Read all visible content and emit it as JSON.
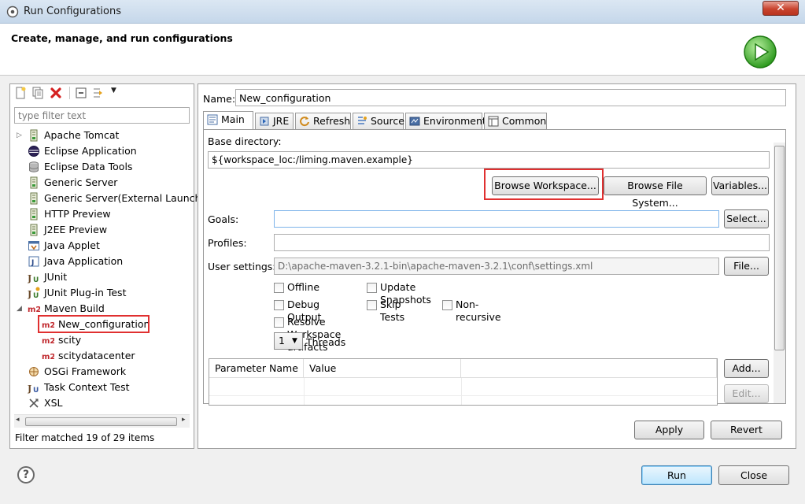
{
  "window": {
    "title": "Run Configurations",
    "close_label": "✕"
  },
  "header": {
    "title": "Create, manage, and run configurations"
  },
  "left": {
    "filter_placeholder": "type filter text",
    "status": "Filter matched 19 of 29 items",
    "tree": [
      {
        "label": "Apache Tomcat",
        "icon": "server-icon",
        "expander": "▷"
      },
      {
        "label": "Eclipse Application",
        "icon": "eclipse-icon"
      },
      {
        "label": "Eclipse Data Tools",
        "icon": "database-icon"
      },
      {
        "label": "Generic Server",
        "icon": "server-icon"
      },
      {
        "label": "Generic Server(External Launch)",
        "icon": "server-icon"
      },
      {
        "label": "HTTP Preview",
        "icon": "server-icon"
      },
      {
        "label": "J2EE Preview",
        "icon": "server-icon"
      },
      {
        "label": "Java Applet",
        "icon": "applet-icon"
      },
      {
        "label": "Java Application",
        "icon": "java-app-icon"
      },
      {
        "label": "JUnit",
        "icon": "junit-icon"
      },
      {
        "label": "JUnit Plug-in Test",
        "icon": "junit-plugin-icon"
      },
      {
        "label": "Maven Build",
        "icon": "m2-icon",
        "expander": "◢"
      },
      {
        "label": "New_configuration",
        "icon": "m2-icon"
      },
      {
        "label": "scity",
        "icon": "m2-icon"
      },
      {
        "label": "scitydatacenter",
        "icon": "m2-icon"
      },
      {
        "label": "OSGi Framework",
        "icon": "osgi-icon"
      },
      {
        "label": "Task Context Test",
        "icon": "task-context-icon"
      },
      {
        "label": "XSL",
        "icon": "xsl-icon"
      }
    ]
  },
  "right": {
    "name_label": "Name:",
    "name_value": "New_configuration",
    "tabs": [
      "Main",
      "JRE",
      "Refresh",
      "Source",
      "Environment",
      "Common"
    ],
    "base_dir_label": "Base directory:",
    "base_dir_value": "${workspace_loc:/liming.maven.example}",
    "browse_workspace": "Browse Workspace...",
    "browse_fs": "Browse File System...",
    "variables": "Variables...",
    "goals_label": "Goals:",
    "goals_value": "",
    "select_button": "Select...",
    "profiles_label": "Profiles:",
    "profiles_value": "",
    "user_settings_label": "User settings:",
    "user_settings_value": "D:\\apache-maven-3.2.1-bin\\apache-maven-3.2.1\\conf\\settings.xml",
    "file_button": "File...",
    "offline": "Offline",
    "update_snapshots": "Update Snapshots",
    "debug_output": "Debug Output",
    "skip_tests": "Skip Tests",
    "non_recursive": "Non-recursive",
    "resolve_workspace": "Resolve Workspace artifacts",
    "threads_value": "1",
    "threads_label": "Threads",
    "param_col_name": "Parameter Name",
    "param_col_value": "Value",
    "add_button": "Add...",
    "edit_button": "Edit...",
    "apply": "Apply",
    "revert": "Revert"
  },
  "footer": {
    "help": "?",
    "run": "Run",
    "close": "Close"
  },
  "colors": {
    "highlight": "#e03030",
    "m2_red": "#c0282d"
  }
}
